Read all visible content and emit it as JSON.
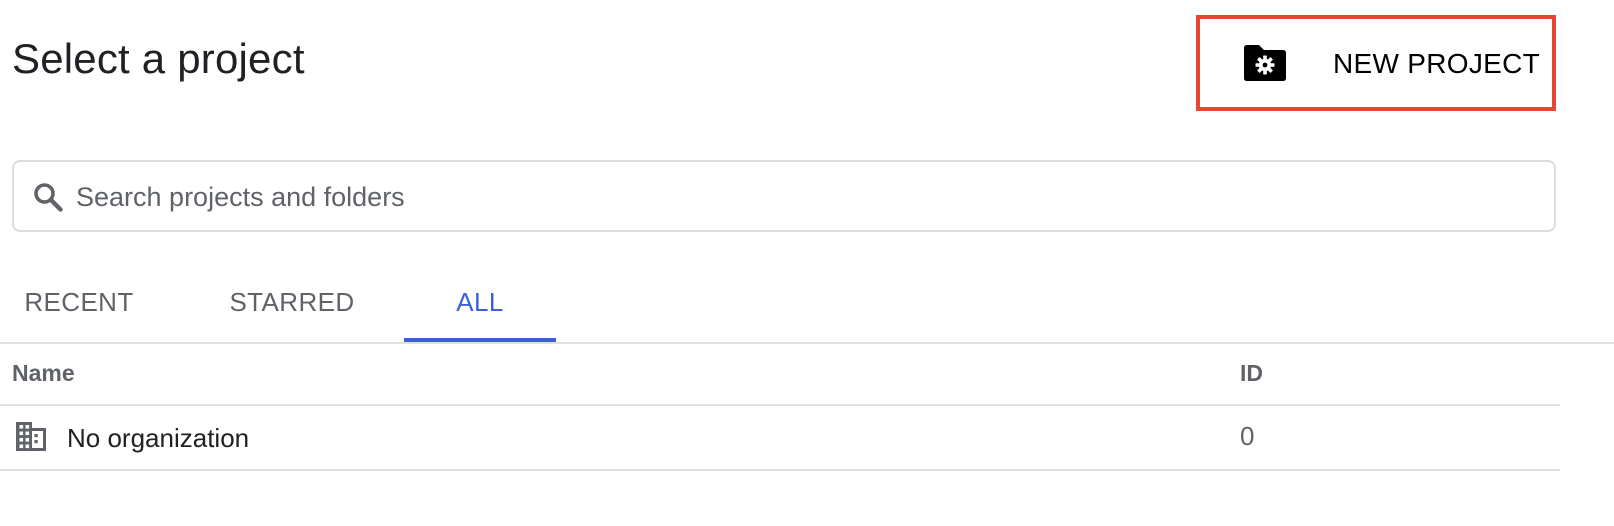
{
  "dialog": {
    "title": "Select a project"
  },
  "toolbar": {
    "new_project_label": "NEW PROJECT",
    "new_project_icon": "folder-gear-icon",
    "highlight_color": "#e2472f"
  },
  "search": {
    "placeholder": "Search projects and folders",
    "value": "",
    "icon": "search-icon"
  },
  "tabs": [
    {
      "label": "RECENT",
      "active": false
    },
    {
      "label": "STARRED",
      "active": false
    },
    {
      "label": "ALL",
      "active": true
    }
  ],
  "accent_color": "#3b5fd9",
  "table": {
    "columns": [
      "Name",
      "ID"
    ],
    "rows": [
      {
        "icon": "organization-building-icon",
        "name": "No organization",
        "id": "0"
      }
    ]
  }
}
